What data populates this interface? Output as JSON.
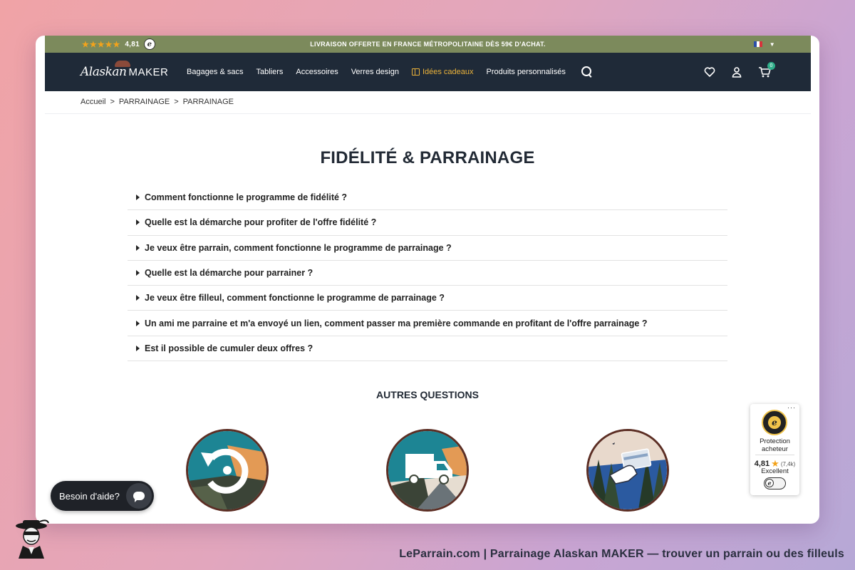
{
  "promo": {
    "rating_stars": "★★★★★",
    "rating_value": "4,81",
    "message": "LIVRAISON OFFERTE EN FRANCE MÉTROPOLITAINE DÈS 59€ D'ACHAT."
  },
  "brand": {
    "logo_script": "Alaskan",
    "logo_word": "MAKER"
  },
  "nav": {
    "items": [
      "Bagages & sacs",
      "Tabliers",
      "Accessoires",
      "Verres design",
      "Idées cadeaux",
      "Produits personnalisés"
    ],
    "cart_count": "0"
  },
  "breadcrumb": [
    "Accueil",
    "PARRAINAGE",
    "PARRAINAGE"
  ],
  "breadcrumb_separator": ">",
  "page_title": "FIDÉLITÉ & PARRAINAGE",
  "faq": [
    "Comment fonctionne le programme de fidélité ?",
    "Quelle est la démarche pour profiter de l'offre fidélité ?",
    "Je veux être parrain, comment fonctionne le programme de parrainage ?",
    "Quelle est la démarche pour parrainer ?",
    "Je veux être filleul, comment fonctionne le programme de parrainage ?",
    "Un ami me parraine et m'a envoyé un lien, comment passer ma première commande en profitant de l'offre parrainage ?",
    "Est il possible de cumuler deux offres ?"
  ],
  "other_questions_title": "AUTRES QUESTIONS",
  "other_questions_icons": [
    "returns-icon",
    "delivery-truck-icon",
    "payment-card-icon"
  ],
  "help_chat": {
    "label": "Besoin d'aide?"
  },
  "trusted_shops": {
    "line1": "Protection",
    "line2": "acheteur",
    "score": "4,81",
    "count": "(7,4k)",
    "label": "Excellent"
  },
  "caption": "LeParrain.com | Parrainage Alaskan MAKER — trouver un parrain ou des filleuls",
  "colors": {
    "promo_bar": "#7c8a5c",
    "header": "#1f2a38",
    "gift_accent": "#e9b13a",
    "star": "#f3a31b",
    "cart_badge": "#2fae8a"
  }
}
